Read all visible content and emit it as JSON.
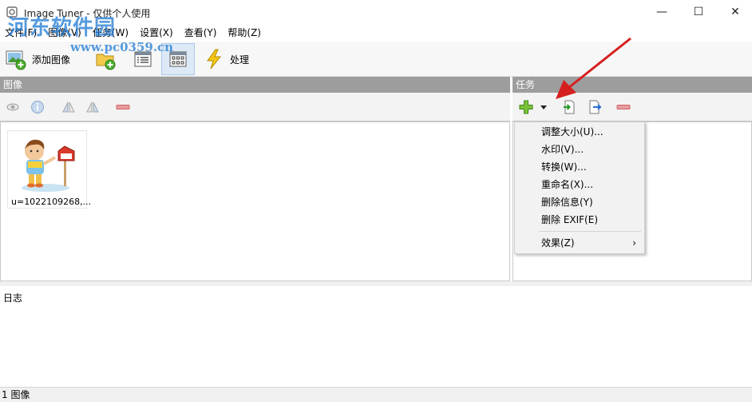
{
  "window": {
    "title": "Image Tuner - 仅供个人使用",
    "min_glyph": "—",
    "max_glyph": "☐",
    "close_glyph": "✕"
  },
  "watermark": {
    "text": "河东软件园",
    "url": "www.pc0359.cn"
  },
  "menubar": [
    "文件(F)",
    "图像(V)",
    "任务(W)",
    "设置(X)",
    "查看(Y)",
    "帮助(Z)"
  ],
  "toolbar": {
    "add_image_label": "添加图像",
    "process_label": "处理"
  },
  "images_panel": {
    "header": "图像",
    "thumbnail_caption": "u=1022109268,..."
  },
  "tasks_panel": {
    "header": "任务"
  },
  "task_menu": {
    "items": [
      "调整大小(U)...",
      "水印(V)...",
      "转换(W)...",
      "重命名(X)...",
      "删除信息(Y)",
      "删除 EXIF(E)"
    ],
    "submenu_item": "效果(Z)",
    "submenu_arrow": "›"
  },
  "log": {
    "label": "日志"
  },
  "status": {
    "text": "1 图像"
  },
  "colors": {
    "section_header": "#9d9d9d",
    "accent_blue": "#2b7bd4",
    "annotation_arrow": "#d62020"
  }
}
